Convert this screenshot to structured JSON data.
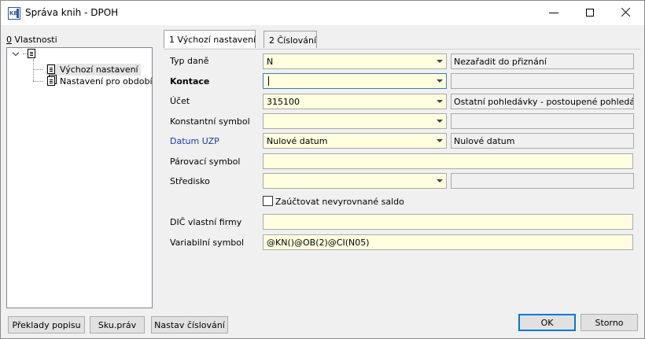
{
  "window": {
    "title": "Správa knih - DPOH",
    "app_icon_text": "KB"
  },
  "properties": {
    "label_hotkey": "0",
    "label_rest": " Vlastnosti",
    "tree": [
      {
        "label": "Výchozí nastavení",
        "selected": true
      },
      {
        "label": "Nastavení pro období",
        "selected": false
      }
    ]
  },
  "tabs": [
    {
      "label": "1 Výchozí nastavení",
      "active": true
    },
    {
      "label": "2 Číslování",
      "active": false
    }
  ],
  "form": {
    "typ_dane": {
      "label": "Typ daně",
      "value": "N",
      "desc": "Nezařadit do přiznání"
    },
    "kontace": {
      "label": "Kontace",
      "value": "",
      "desc": ""
    },
    "ucet": {
      "label": "Účet",
      "value": "315100",
      "desc": "Ostatní pohledávky - postoupené pohledávky"
    },
    "konst_symbol": {
      "label": "Konstantní symbol",
      "value": "",
      "desc": ""
    },
    "datum_uzp": {
      "label": "Datum UZP",
      "value": "Nulové datum",
      "desc": "Nulové datum"
    },
    "parovaci_symbol": {
      "label": "Párovací symbol",
      "value": ""
    },
    "stredisko": {
      "label": "Středisko",
      "value": "",
      "desc": ""
    },
    "zauctovat": {
      "label": "Zaúčtovat nevyrovnané saldo",
      "checked": false
    },
    "dic": {
      "label": "DIČ vlastní firmy",
      "value": ""
    },
    "var_symbol": {
      "label": "Variabilní symbol",
      "value": "@KN()@OB(2)@CI(N05)"
    }
  },
  "buttons": {
    "preklady": "Překlady popisu",
    "sku_prav": "Sku.práv",
    "nastav_cislovani": "Nastav číslování",
    "ok": "OK",
    "storno": "Storno"
  },
  "colors": {
    "field_bg": "#ffffe0",
    "accent": "#0078d7",
    "label_blue": "#1a3aa8"
  }
}
